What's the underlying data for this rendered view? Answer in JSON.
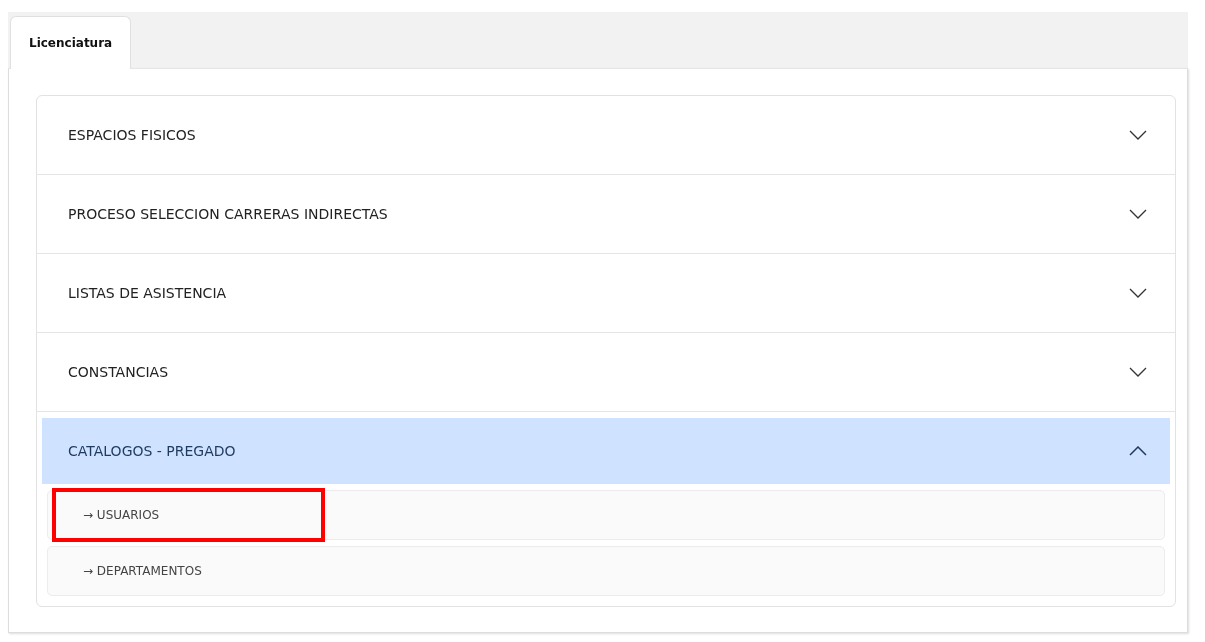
{
  "tabs": [
    {
      "label": "Licenciatura",
      "selected": true
    }
  ],
  "sections": [
    {
      "title": "ESPACIOS FISICOS",
      "expanded": false
    },
    {
      "title": "PROCESO SELECCION CARRERAS INDIRECTAS",
      "expanded": false
    },
    {
      "title": "LISTAS DE ASISTENCIA",
      "expanded": false
    },
    {
      "title": "CONSTANCIAS",
      "expanded": false
    },
    {
      "title": "CATALOGOS - PREGADO",
      "expanded": true,
      "children": [
        {
          "label": "→ USUARIOS",
          "highlighted": true
        },
        {
          "label": "→ DEPARTAMENTOS",
          "highlighted": false
        }
      ]
    }
  ]
}
